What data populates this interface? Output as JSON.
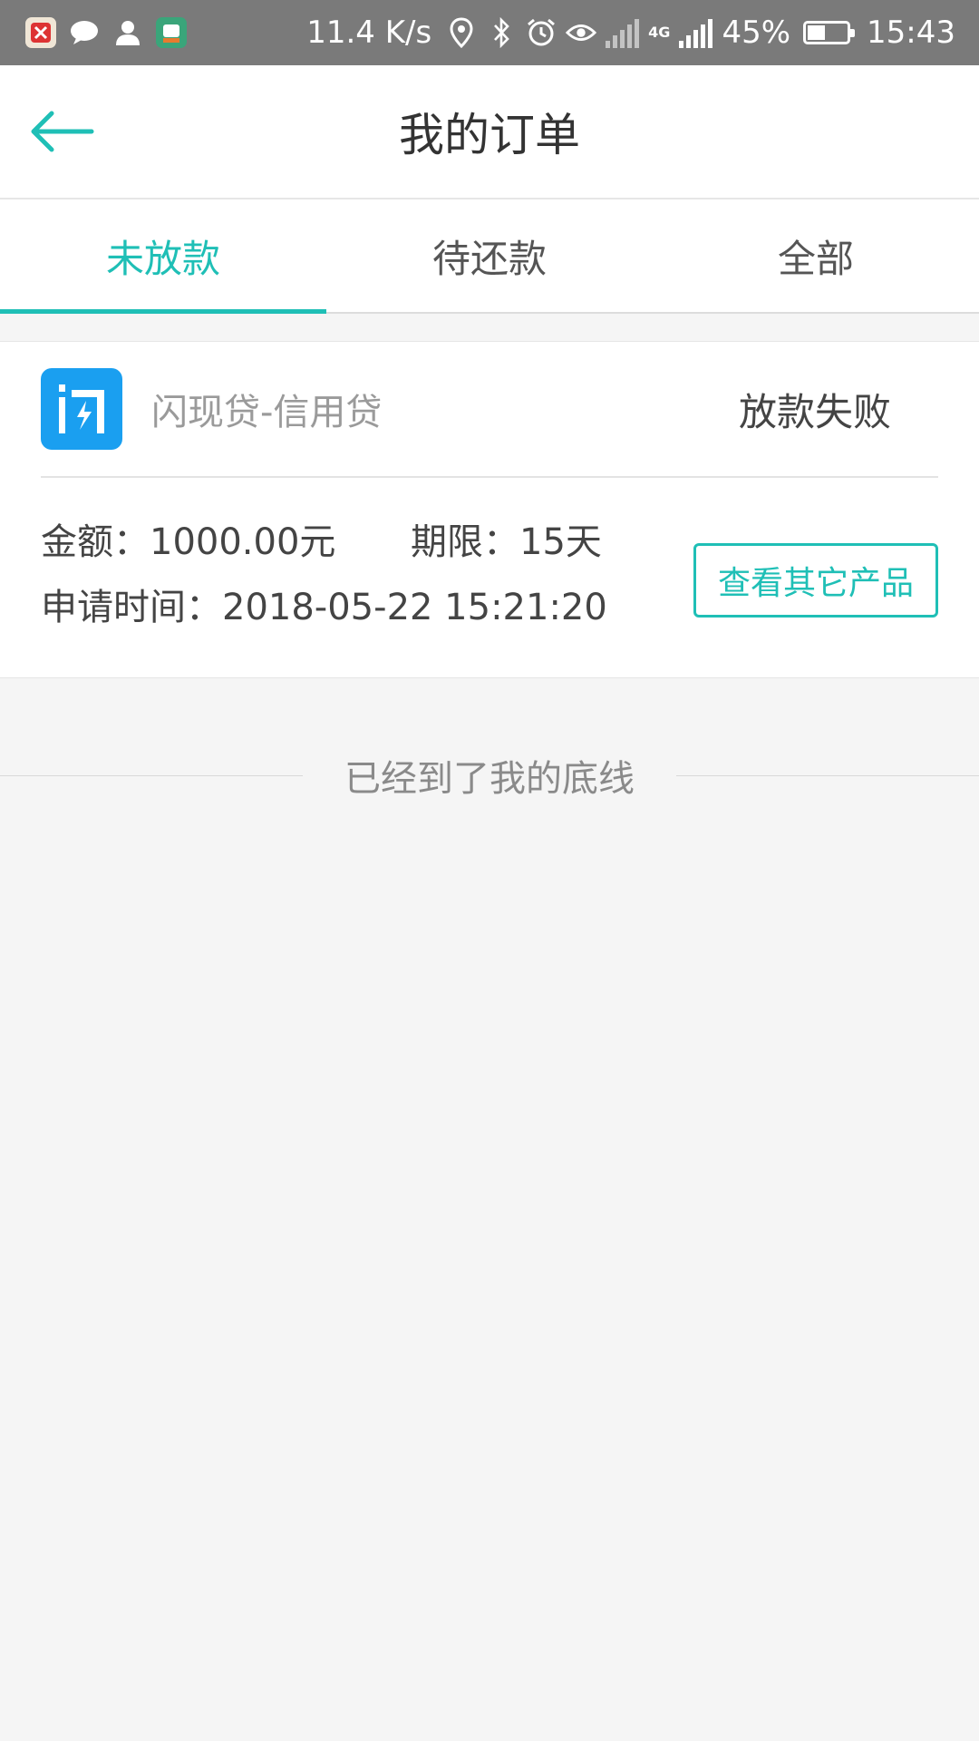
{
  "status_bar": {
    "net_speed": "11.4 K/s",
    "network_type": "4G",
    "battery_percent": "45%",
    "battery_level": 0.45,
    "time": "15:43",
    "left_icons": [
      "app-notification-icon",
      "chat-icon",
      "contact-icon",
      "app-notification-icon-2"
    ],
    "right_icons": [
      "location-icon",
      "bluetooth-icon",
      "alarm-icon",
      "eye-icon",
      "no-signal-icon",
      "signal-icon",
      "battery-icon"
    ]
  },
  "header": {
    "title": "我的订单",
    "back_icon": "back-arrow-icon"
  },
  "tabs": [
    {
      "label": "未放款",
      "active": true
    },
    {
      "label": "待还款",
      "active": false
    },
    {
      "label": "全部",
      "active": false
    }
  ],
  "order": {
    "product_name": "闪现贷-信用贷",
    "status": "放款失败",
    "amount_label": "金额：",
    "amount_value": "1000.00元",
    "term_label": "期限：",
    "term_value": "15天",
    "apply_time_label": "申请时间：",
    "apply_time_value": "2018-05-22 15:21:20",
    "action_label": "查看其它产品",
    "logo_text": "闪"
  },
  "footer": {
    "end_text": "已经到了我的底线"
  },
  "colors": {
    "accent": "#1fbfb6",
    "logo_bg": "#1a9ff0",
    "status_bar_bg": "#7a7a7a",
    "page_bg": "#f5f5f5"
  }
}
